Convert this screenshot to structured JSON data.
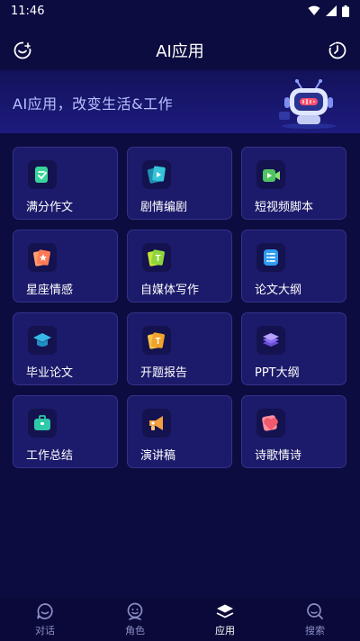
{
  "status": {
    "time": "11:46"
  },
  "header": {
    "title": "AI应用"
  },
  "banner": {
    "text": "AI应用，改变生活&工作"
  },
  "apps": [
    {
      "label": "满分作文",
      "icon": "essay-icon",
      "color": "#38d59a"
    },
    {
      "label": "剧情编剧",
      "icon": "script-cards-icon",
      "color": "#35c4d8"
    },
    {
      "label": "短视频脚本",
      "icon": "video-icon",
      "color": "#4fc562"
    },
    {
      "label": "星座情感",
      "icon": "star-cards-icon",
      "color": "#ff7a56"
    },
    {
      "label": "自媒体写作",
      "icon": "text-cards-icon",
      "color": "#8fd63a"
    },
    {
      "label": "论文大纲",
      "icon": "list-icon",
      "color": "#2f9cf2"
    },
    {
      "label": "毕业论文",
      "icon": "graduation-cap-icon",
      "color": "#36b9e6"
    },
    {
      "label": "开题报告",
      "icon": "report-cards-icon",
      "color": "#f0a22a"
    },
    {
      "label": "PPT大纲",
      "icon": "layers-icon",
      "color": "#8b6cf5"
    },
    {
      "label": "工作总结",
      "icon": "briefcase-icon",
      "color": "#2ec9a8"
    },
    {
      "label": "演讲稿",
      "icon": "megaphone-icon",
      "color": "#f2a040"
    },
    {
      "label": "诗歌情诗",
      "icon": "heart-card-icon",
      "color": "#f05a6a"
    }
  ],
  "nav": [
    {
      "label": "对话",
      "icon": "chat-icon",
      "active": false
    },
    {
      "label": "角色",
      "icon": "person-icon",
      "active": false
    },
    {
      "label": "应用",
      "icon": "apps-stack-icon",
      "active": true
    },
    {
      "label": "搜索",
      "icon": "search-icon",
      "active": false
    }
  ]
}
